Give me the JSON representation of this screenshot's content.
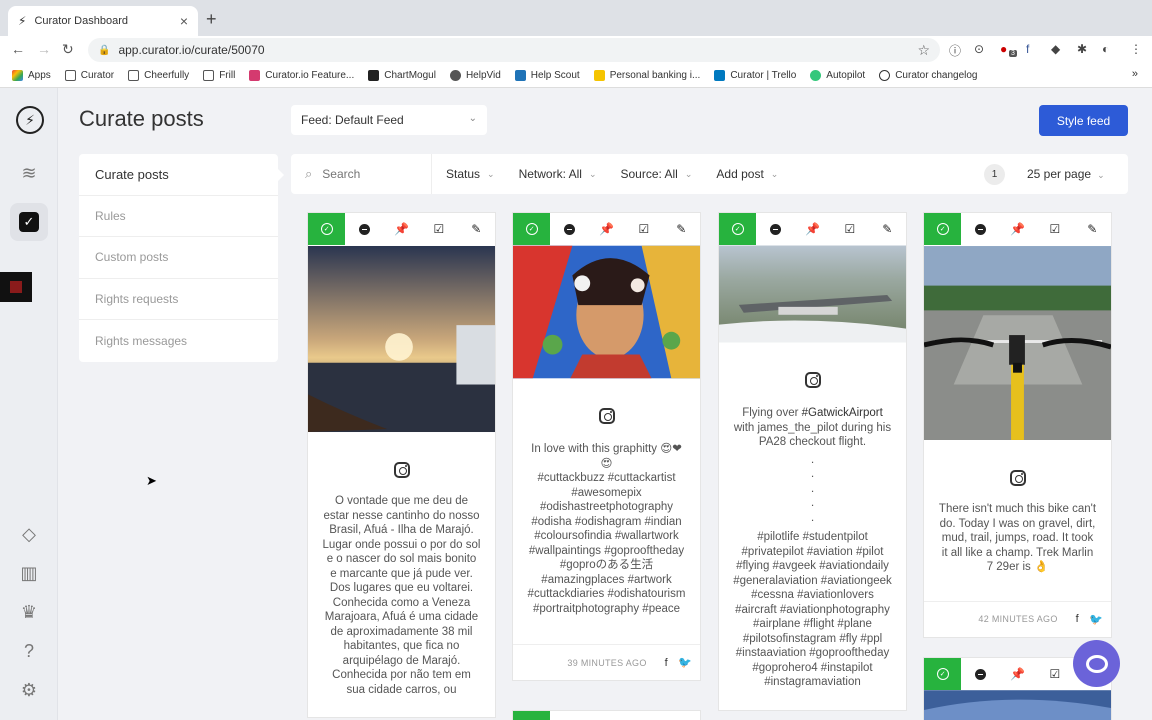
{
  "browser": {
    "tab_title": "Curator Dashboard",
    "url": "app.curator.io/curate/50070",
    "bookmarks": [
      "Apps",
      "Curator",
      "Cheerfully",
      "Frill",
      "Curator.io Feature...",
      "ChartMogul",
      "HelpVid",
      "Help Scout",
      "Personal banking i...",
      "Curator | Trello",
      "Autopilot",
      "Curator changelog"
    ],
    "ext_badge": "3"
  },
  "header": {
    "page_title": "Curate posts",
    "feed_select": "Feed: Default Feed",
    "style_button": "Style feed"
  },
  "submenu": {
    "items": [
      "Curate posts",
      "Rules",
      "Custom posts",
      "Rights requests",
      "Rights messages"
    ]
  },
  "toolbar": {
    "search_placeholder": "Search",
    "status": "Status",
    "network": "Network: All",
    "source": "Source: All",
    "add_post": "Add post",
    "page": "1",
    "per_page": "25 per page"
  },
  "posts": [
    {
      "text": "O vontade que me deu de estar nesse cantinho do nosso Brasil, Afuá - Ilha de Marajó. Lugar onde possui o por do sol e o nascer do sol mais bonito e marcante que já pude ver. Dos lugares que eu voltarei. Conhecida como a Veneza Marajoara, Afuá é uma cidade de aproximadamente 38 mil habitantes, que fica no arquipélago de Marajó. Conhecida por não tem em sua cidade carros, ou"
    },
    {
      "text": "In love with this graphitty 😍❤😍",
      "tags": "#cuttackbuzz #cuttackartist #awesomepix #odishastreetphotography #odisha #odishagram #indian #coloursofindia #wallartwork #wallpaintings #goprooftheday #goproのある生活 #amazingplaces #artwork #cuttackdiaries #odishatourism #portraitphotography #peace",
      "time": "39 MINUTES AGO"
    },
    {
      "text_prefix": "Flying over ",
      "text_highlight": "#GatwickAirport",
      "text_suffix": " with james_the_pilot during his PA28 checkout flight.",
      "tags": "#pilotlife #studentpilot #privatepilot #aviation #pilot #flying #avgeek #aviationdaily #generalaviation #aviationgeek #cessna #aviationlovers #aircraft #aviationphotography #airplane #flight #plane #pilotsofinstagram #fly #ppl #instaaviation #goprooftheday #goprohero4 #instapilot #instagramaviation"
    },
    {
      "text": "There isn't much this bike can't do. Today I was on gravel, dirt, mud, trail, jumps, road. It took it all like a champ. Trek Marlin 7 29er is 👌",
      "time": "42 MINUTES AGO"
    }
  ],
  "colors": {
    "approve_green": "#27b33e",
    "primary_blue": "#2d5bd7",
    "help_purple": "#6b63d9"
  }
}
